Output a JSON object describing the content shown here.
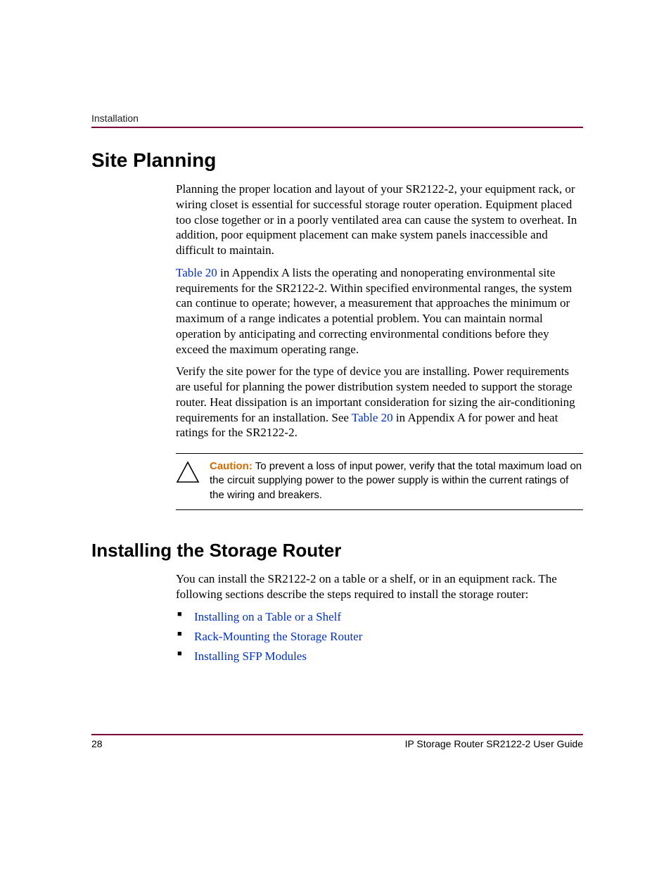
{
  "header": {
    "running_head": "Installation"
  },
  "section1": {
    "title": "Site Planning",
    "para1": "Planning the proper location and layout of your SR2122-2, your equipment rack, or wiring closet is essential for successful storage router operation. Equipment placed too close together or in a poorly ventilated area can cause the system to overheat. In addition, poor equipment placement can make system panels inaccessible and difficult to maintain.",
    "para2_link": "Table 20",
    "para2_rest": " in Appendix A lists the operating and nonoperating environmental site requirements for the SR2122-2. Within specified environmental ranges, the system can continue to operate; however, a measurement that approaches the minimum or maximum of a range indicates a potential problem. You can maintain normal operation by anticipating and correcting environmental conditions before they exceed the maximum operating range.",
    "para3_a": "Verify the site power for the type of device you are installing. Power requirements are useful for planning the power distribution system needed to support the storage router. Heat dissipation is an important consideration for sizing the air-conditioning requirements for an installation. See ",
    "para3_link": "Table 20",
    "para3_b": " in Appendix A for power and heat ratings for the SR2122-2."
  },
  "caution": {
    "label": "Caution:",
    "text": "  To prevent a loss of input power, verify that the total maximum load on the circuit supplying power to the power supply is within the current ratings of the wiring and breakers."
  },
  "section2": {
    "title": "Installing the Storage Router",
    "intro": "You can install the SR2122-2 on a table or a shelf, or in an equipment rack. The following sections describe the steps required to install the storage router:",
    "links": [
      "Installing on a Table or a Shelf",
      "Rack-Mounting the Storage Router",
      "Installing SFP Modules"
    ]
  },
  "footer": {
    "page_number": "28",
    "doc_title": "IP Storage Router SR2122-2 User Guide"
  }
}
